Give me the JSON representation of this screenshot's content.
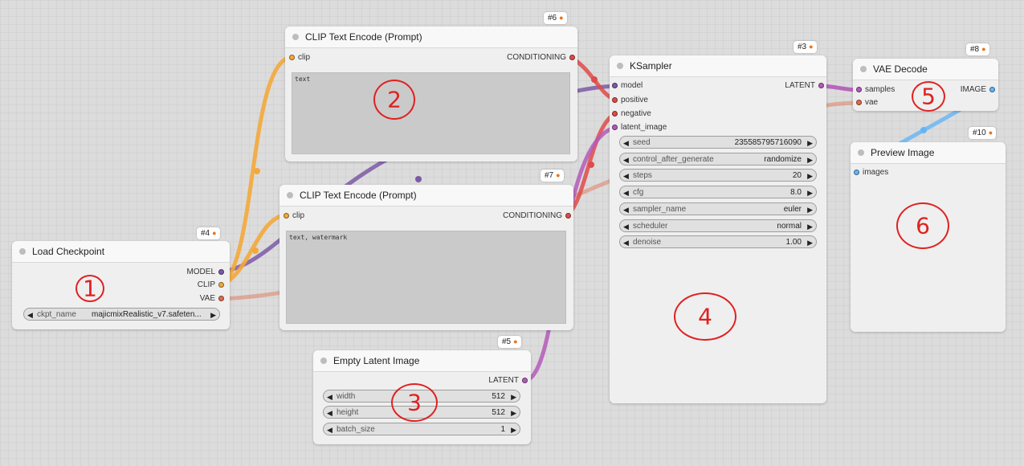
{
  "colors": {
    "model": "#7c5aa6",
    "clip": "#f3a93a",
    "vae": "#e06c4a",
    "conditioning": "#e04a4a",
    "latent": "#b45ab8",
    "image": "#64b5f6",
    "annotation": "#e02020"
  },
  "nodes": {
    "load_checkpoint": {
      "id": "#4",
      "title": "Load Checkpoint",
      "outputs": [
        "MODEL",
        "CLIP",
        "VAE"
      ],
      "widgets": [
        {
          "label": "ckpt_name",
          "value": "majicmixRealistic_v7.safeten..."
        }
      ],
      "annotation": "1"
    },
    "clip_text_encode_positive": {
      "id": "#6",
      "title": "CLIP Text Encode (Prompt)",
      "input": "clip",
      "output": "CONDITIONING",
      "text": "text",
      "annotation": "2"
    },
    "clip_text_encode_negative": {
      "id": "#7",
      "title": "CLIP Text Encode (Prompt)",
      "input": "clip",
      "output": "CONDITIONING",
      "text": "text, watermark"
    },
    "empty_latent_image": {
      "id": "#5",
      "title": "Empty Latent Image",
      "output": "LATENT",
      "widgets": [
        {
          "label": "width",
          "value": "512"
        },
        {
          "label": "height",
          "value": "512"
        },
        {
          "label": "batch_size",
          "value": "1"
        }
      ],
      "annotation": "3"
    },
    "ksampler": {
      "id": "#3",
      "title": "KSampler",
      "inputs": [
        "model",
        "positive",
        "negative",
        "latent_image"
      ],
      "output": "LATENT",
      "widgets": [
        {
          "label": "seed",
          "value": "235585795716090"
        },
        {
          "label": "control_after_generate",
          "value": "randomize"
        },
        {
          "label": "steps",
          "value": "20"
        },
        {
          "label": "cfg",
          "value": "8.0"
        },
        {
          "label": "sampler_name",
          "value": "euler"
        },
        {
          "label": "scheduler",
          "value": "normal"
        },
        {
          "label": "denoise",
          "value": "1.00"
        }
      ],
      "annotation": "4"
    },
    "vae_decode": {
      "id": "#8",
      "title": "VAE Decode",
      "inputs": [
        "samples",
        "vae"
      ],
      "output": "IMAGE",
      "annotation": "5"
    },
    "preview_image": {
      "id": "#10",
      "title": "Preview Image",
      "input": "images",
      "annotation": "6"
    }
  }
}
